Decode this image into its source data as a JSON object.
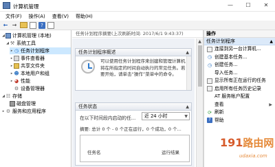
{
  "window": {
    "title": "计算机管理"
  },
  "menu": [
    "文件(F)",
    "操作(A)",
    "查看(V)",
    "帮助(H)"
  ],
  "tree": {
    "items": [
      {
        "label": "计算机管理 (本地)",
        "icon": "computer-icon",
        "level": 0,
        "expanded": true
      },
      {
        "label": "系统工具",
        "icon": "tools-icon",
        "level": 1,
        "expanded": true
      },
      {
        "label": "任务计划程序",
        "icon": "clock-icon",
        "level": 2,
        "selected": true
      },
      {
        "label": "事件查看器",
        "icon": "event-log-icon",
        "level": 2
      },
      {
        "label": "共享文件夹",
        "icon": "shared-folder-icon",
        "level": 2
      },
      {
        "label": "本地用户和组",
        "icon": "users-icon",
        "level": 2
      },
      {
        "label": "性能",
        "icon": "performance-icon",
        "level": 2
      },
      {
        "label": "设备管理器",
        "icon": "device-manager-icon",
        "level": 2
      },
      {
        "label": "存储",
        "icon": "storage-icon",
        "level": 1,
        "expanded": true
      },
      {
        "label": "磁盘管理",
        "icon": "disk-icon",
        "level": 2
      },
      {
        "label": "服务和应用程序",
        "icon": "services-icon",
        "level": 1
      }
    ]
  },
  "center": {
    "header": "任务计划程序摘要(上次刷新时间: 2017/6/1 9:43:37)",
    "overview": {
      "title": "任务计划程序概述",
      "text": "可以使用任务计划程序来创建和管理计算机将在所指定的时间自动执行的常见任务。若要开始，请单击“操作”菜单中的命令。"
    },
    "status": {
      "title": "任务状态",
      "filter_label": "在以下时间段内启动的任...",
      "filter_value": "近 24 小时",
      "summary": "摘要: 总计 0 个 - 0 个正在运行，0 个成功，0 个...",
      "columns": [
        "任务名",
        "运行结果"
      ]
    }
  },
  "actions": {
    "title": "操作",
    "group": "任务计划程序",
    "items": [
      {
        "label": "连接到另一台计算机...",
        "icon": "connect-icon"
      },
      {
        "label": "创建基本任务...",
        "icon": "basic-task-icon"
      },
      {
        "label": "创建任务...",
        "icon": "create-task-icon"
      },
      {
        "label": "导入任务...",
        "icon": "import-icon"
      },
      {
        "label": "显示所有正在运行的任务",
        "icon": "running-tasks-icon"
      },
      {
        "label": "启用所有任务历史记录",
        "icon": "history-icon"
      },
      {
        "label": "AT 服务帐户配置",
        "icon": "at-config-icon"
      },
      {
        "label": "查看",
        "icon": "view-icon",
        "submenu": true
      },
      {
        "label": "刷新",
        "icon": "refresh-icon"
      },
      {
        "label": "帮助",
        "icon": "help-icon"
      }
    ]
  },
  "watermark": {
    "main_num": "191",
    "main_text": "路由网",
    "sub": "udaxia.com"
  }
}
